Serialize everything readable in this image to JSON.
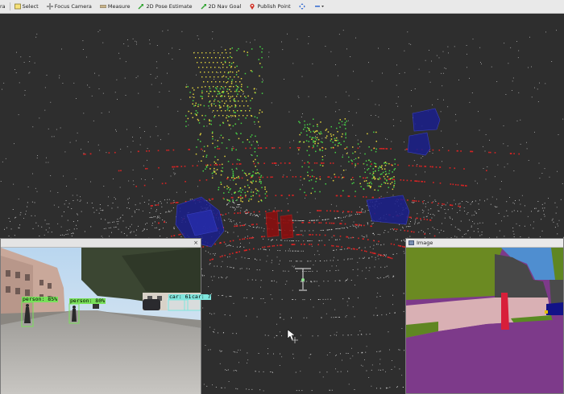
{
  "toolbar": {
    "tools": [
      {
        "name": "interact",
        "label": "ra",
        "icon": "interact-icon"
      },
      {
        "name": "select",
        "label": "Select",
        "icon": "select-icon"
      },
      {
        "name": "focus-camera",
        "label": "Focus Camera",
        "icon": "focus-camera-icon"
      },
      {
        "name": "measure",
        "label": "Measure",
        "icon": "measure-icon"
      },
      {
        "name": "2d-pose-estimate",
        "label": "2D Pose Estimate",
        "icon": "pose-arrow-icon"
      },
      {
        "name": "2d-nav-goal",
        "label": "2D Nav Goal",
        "icon": "nav-goal-arrow-icon"
      },
      {
        "name": "publish-point",
        "label": "Publish Point",
        "icon": "map-pin-icon"
      }
    ]
  },
  "camera_panel": {
    "close_glyph": "×",
    "detections": [
      {
        "label": "person: 85%",
        "class": "person"
      },
      {
        "label": "person: 80%",
        "class": "person"
      },
      {
        "label": "car: 61",
        "class": "car"
      },
      {
        "label": "car: 7",
        "class": "car"
      }
    ]
  },
  "image_panel": {
    "title": "Image"
  },
  "colors": {
    "viewport_bg": "#2e2e2e",
    "lidar_white": "#d8d8d8",
    "lidar_red": "#d82424",
    "lidar_green": "#46d246",
    "lidar_yellow": "#e0d23c",
    "box_blue": "#1a1e8c",
    "box_red": "#8a1010"
  }
}
